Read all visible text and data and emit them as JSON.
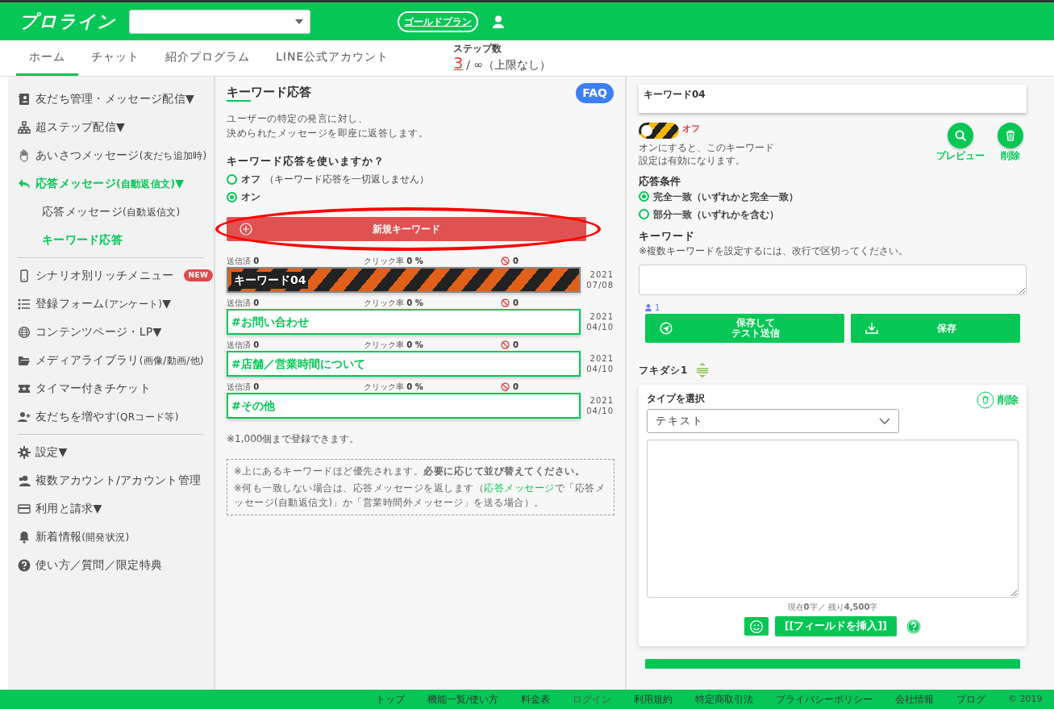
{
  "header": {
    "logo": "プロライン",
    "plan_button": "ゴールドプラン"
  },
  "nav": {
    "tabs": [
      {
        "label": "ホーム",
        "selected": true
      },
      {
        "label": "チャット",
        "selected": false
      },
      {
        "label": "紹介プログラム",
        "selected": false
      },
      {
        "label": "LINE公式アカウント",
        "selected": false
      }
    ],
    "step_count": {
      "label": "ステップ数",
      "used": "3",
      "limit": "/ ∞（上限なし）"
    }
  },
  "sidebar": {
    "groups": [
      [
        {
          "label": "友だち管理・メッセージ配信▼",
          "active": false
        },
        {
          "label": "超ステップ配信▼",
          "active": false
        },
        {
          "label": "あいさつメッセージ",
          "note": "(友だち追加時)",
          "active": false
        },
        {
          "label": "応答メッセージ",
          "note": "(自動返信文)",
          "suffix": "▼",
          "active": true,
          "children": [
            {
              "label": "応答メッセージ",
              "note": "(自動返信文)",
              "active": false
            },
            {
              "label": "キーワード応答",
              "active": true
            }
          ]
        }
      ],
      [
        {
          "label": "シナリオ別リッチメニュー",
          "badge": "NEW",
          "active": false
        },
        {
          "label": "登録フォーム",
          "note": "(アンケート)",
          "suffix": "▼",
          "active": false
        },
        {
          "label": "コンテンツページ・LP▼",
          "active": false
        },
        {
          "label": "メディアライブラリ",
          "note": "(画像/動画/他)",
          "active": false
        },
        {
          "label": "タイマー付きチケット",
          "active": false
        },
        {
          "label": "友だちを増やす",
          "note": "(QRコード等)",
          "active": false
        }
      ],
      [
        {
          "label": "設定▼",
          "active": false
        },
        {
          "label": "複数アカウント/アカウント管理",
          "active": false
        },
        {
          "label": "利用と請求▼",
          "active": false
        },
        {
          "label": "新着情報",
          "note": "(開発状況)",
          "active": false
        },
        {
          "label": "使い方／質問／限定特典",
          "active": false
        }
      ]
    ]
  },
  "keyword_panel": {
    "title": "キーワード応答",
    "faq_button": "FAQ",
    "description": [
      "ユーザーの特定の発言に対し、",
      "決められたメッセージを即座に返答します。"
    ],
    "question": "キーワード応答を使いますか？",
    "options": [
      {
        "label": "オフ",
        "note": "（キーワード応答を一切返しません）",
        "selected": false
      },
      {
        "label": "オン",
        "selected": true
      }
    ],
    "new_keyword_button": {
      "label": "新規キーワード",
      "highlighted": true
    },
    "keywords": [
      {
        "sent_label": "送信済",
        "sent": "0",
        "click_label": "クリック率",
        "click": "0 %",
        "blocked": "0",
        "name": "キーワード04",
        "enabled": false,
        "year": "2021",
        "date": "07/08"
      },
      {
        "sent_label": "送信済",
        "sent": "0",
        "click_label": "クリック率",
        "click": "0 %",
        "blocked": "0",
        "name": "#お問い合わせ",
        "enabled": true,
        "year": "2021",
        "date": "04/10"
      },
      {
        "sent_label": "送信済",
        "sent": "0",
        "click_label": "クリック率",
        "click": "0 %",
        "blocked": "0",
        "name": "#店舗／営業時間について",
        "enabled": true,
        "year": "2021",
        "date": "04/10"
      },
      {
        "sent_label": "送信済",
        "sent": "0",
        "click_label": "クリック率",
        "click": "0 %",
        "blocked": "0",
        "name": "#その他",
        "enabled": true,
        "year": "2021",
        "date": "04/10"
      }
    ],
    "limit_note": "※1,000個まで登録できます。",
    "notes": {
      "priority": "※上にあるキーワードほど優先されます。**必要に応じて並び替えてください。**",
      "fallback_before": "※何も一致しない場合は、応答メッセージを返します（",
      "fallback_link": "応答メッセージ",
      "fallback_after": "で「応答メッセージ(自動返信文)」か「営業時間外メッセージ」を送る場合）。"
    }
  },
  "editor": {
    "keyword_name": "キーワード04",
    "toggle": {
      "on": false,
      "label": "オフ"
    },
    "toggle_help": [
      "オンにすると、このキーワード",
      "設定は有効になります。"
    ],
    "preview_label": "プレビュー",
    "delete_label": "削除",
    "condition_title": "応答条件",
    "conditions": [
      {
        "label": "完全一致（いずれかと完全一致）",
        "selected": true
      },
      {
        "label": "部分一致（いずれかを含む）",
        "selected": false
      }
    ],
    "keyword_title": "キーワード",
    "keyword_help": "※複数キーワードを設定するには、改行で区切ってください。",
    "recipients": "1",
    "save_test_button": [
      "保存して",
      "テスト送信"
    ],
    "save_button": "保存",
    "bubble_title": "フキダシ1",
    "bubble": {
      "type_label": "タイプを選択",
      "type_value": "テキスト",
      "delete_label": "削除",
      "counter": "現在**0**字／ 残り**4,500**字",
      "insert_field_button": "[[フィールドを挿入]]"
    }
  },
  "footer": {
    "links": [
      "トップ",
      "機能一覧/使い方",
      "料金表",
      "ログイン",
      "利用規約",
      "特定商取引法",
      "プライバシーポリシー",
      "会社情報",
      "ブログ"
    ],
    "copyright": "© 2019"
  }
}
